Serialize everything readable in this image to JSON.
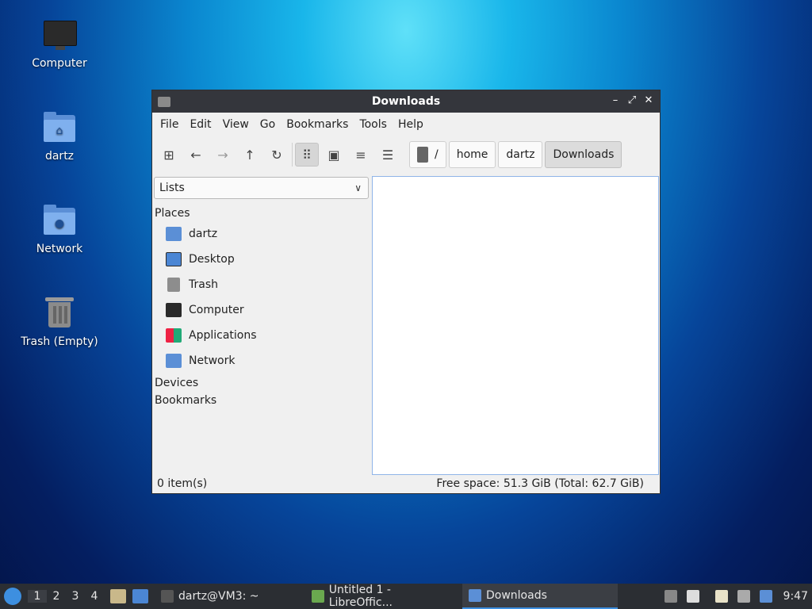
{
  "desktop": {
    "icons": [
      {
        "label": "Computer"
      },
      {
        "label": "dartz"
      },
      {
        "label": "Network"
      },
      {
        "label": "Trash (Empty)"
      }
    ]
  },
  "window": {
    "title": "Downloads",
    "menu": [
      "File",
      "Edit",
      "View",
      "Go",
      "Bookmarks",
      "Tools",
      "Help"
    ],
    "toolbar": {
      "icons": [
        "new-tab-icon",
        "back-icon",
        "forward-icon",
        "up-icon",
        "reload-icon",
        "icon-view-icon",
        "thumbnail-view-icon",
        "compact-view-icon",
        "detailed-list-icon"
      ],
      "path": [
        "/",
        "home",
        "dartz",
        "Downloads"
      ]
    },
    "sidebar": {
      "mode": "Lists",
      "sections": {
        "places": "Places",
        "devices": "Devices",
        "bookmarks": "Bookmarks"
      },
      "places": [
        "dartz",
        "Desktop",
        "Trash",
        "Computer",
        "Applications",
        "Network"
      ]
    },
    "status": {
      "items": "0 item(s)",
      "space": "Free space: 51.3 GiB (Total: 62.7 GiB)"
    }
  },
  "taskbar": {
    "workspaces": [
      "1",
      "2",
      "3",
      "4"
    ],
    "tasks": [
      {
        "label": "dartz@VM3: ~"
      },
      {
        "label": "Untitled 1 - LibreOffic..."
      },
      {
        "label": "Downloads"
      }
    ],
    "clock": "9:47"
  }
}
